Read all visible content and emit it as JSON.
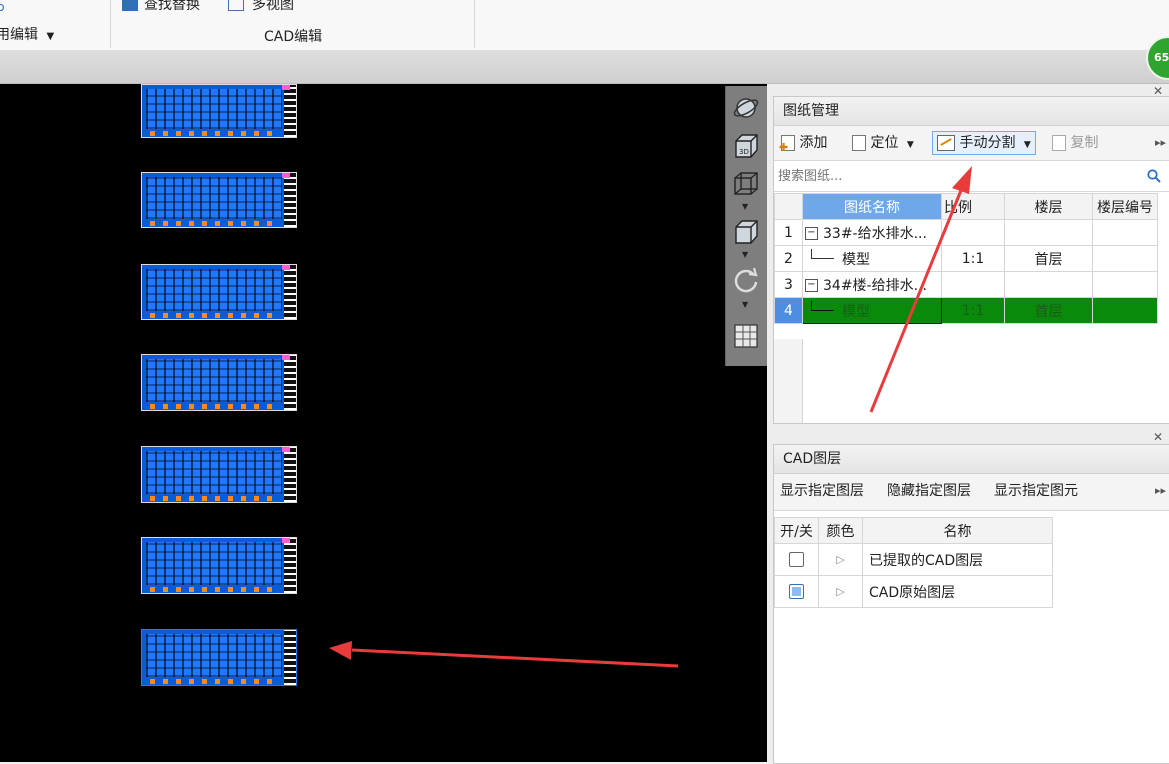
{
  "ribbon": {
    "btn_find_replace": "查找替换",
    "btn_multi_view": "多视图",
    "group_left_label": "用编辑",
    "group_cad_label": "CAD编辑"
  },
  "badge": "65",
  "drawing_panel": {
    "title": "图纸管理",
    "toolbar": {
      "add": "添加",
      "locate": "定位",
      "manual_split": "手动分割",
      "copy": "复制"
    },
    "search_placeholder": "搜索图纸...",
    "columns": [
      "图纸名称",
      "比例",
      "楼层",
      "楼层编号"
    ],
    "rows": [
      {
        "num": "1",
        "name": "33#-给水排水...",
        "scale": "",
        "floor": "",
        "floor_no": ""
      },
      {
        "num": "2",
        "name": "模型",
        "scale": "1:1",
        "floor": "首层",
        "floor_no": ""
      },
      {
        "num": "3",
        "name": "34#楼-给排水...",
        "scale": "",
        "floor": "",
        "floor_no": ""
      },
      {
        "num": "4",
        "name": "模型",
        "scale": "1:1",
        "floor": "首层",
        "floor_no": ""
      }
    ],
    "selected_row": 4
  },
  "layer_panel": {
    "title": "CAD图层",
    "toolbar": {
      "show_layer": "显示指定图层",
      "hide_layer": "隐藏指定图层",
      "show_element": "显示指定图元"
    },
    "columns": [
      "开/关",
      "颜色",
      "名称"
    ],
    "rows": [
      {
        "checked": false,
        "name": "已提取的CAD图层"
      },
      {
        "checked": true,
        "name": "CAD原始图层"
      }
    ]
  },
  "colors": {
    "selection_green": "#0a8a0a",
    "annotation_red": "#e83c3c",
    "drawing_blue": "#1f78ff"
  },
  "icons": [
    "find-replace-icon",
    "multi-view-icon",
    "orbit-icon",
    "3d-cube-icon",
    "wireframe-cube-icon",
    "solid-cube-icon",
    "rotate-icon",
    "layer-grid-icon",
    "add-drawing-icon",
    "locate-icon",
    "manual-split-icon",
    "copy-icon",
    "search-icon",
    "close-icon",
    "expand-icon",
    "collapse-icon",
    "more-icon"
  ]
}
